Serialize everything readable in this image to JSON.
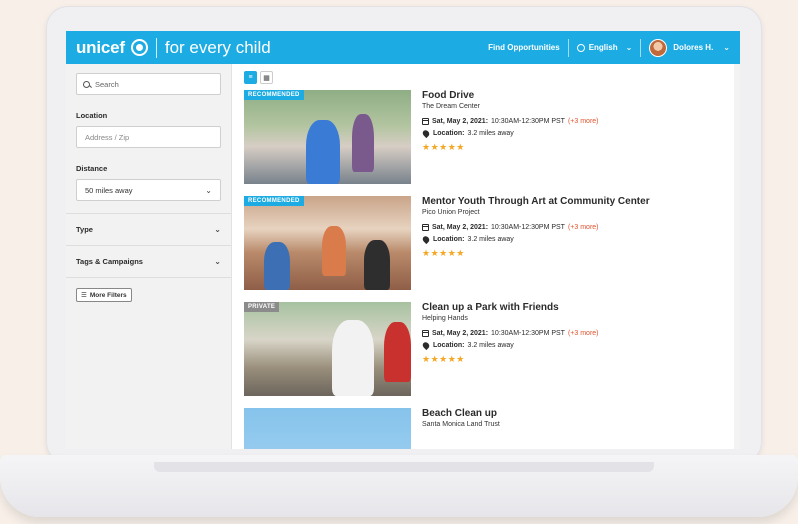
{
  "colors": {
    "brand": "#1cabe2",
    "accent_more": "#e2522c",
    "stars": "#f5a623"
  },
  "header": {
    "logo_word": "unicef",
    "tagline": "for every child",
    "find_opportunities": "Find Opportunities",
    "language": "English",
    "user_name": "Dolores H."
  },
  "sidebar": {
    "search_placeholder": "Search",
    "location_title": "Location",
    "address_placeholder": "Address / Zip",
    "distance_title": "Distance",
    "distance_value": "50 miles away",
    "type_label": "Type",
    "tags_label": "Tags & Campaigns",
    "more_filters": "More Filters"
  },
  "listings": [
    {
      "badge": "RECOMMENDED",
      "title": "Food Drive",
      "org": "The Dream Center",
      "date_label": "Sat, May 2, 2021:",
      "time": "10:30AM-12:30PM PST",
      "more": "(+3 more)",
      "location_label": "Location:",
      "distance": "3.2 miles away",
      "stars": "★★★★★"
    },
    {
      "badge": "RECOMMENDED",
      "title": "Mentor Youth Through Art at Community Center",
      "org": "Pico Union Project",
      "date_label": "Sat, May 2, 2021:",
      "time": "10:30AM-12:30PM PST",
      "more": "(+3 more)",
      "location_label": "Location:",
      "distance": "3.2 miles away",
      "stars": "★★★★★"
    },
    {
      "badge": "PRIVATE",
      "title": "Clean up a Park with Friends",
      "org": "Helping Hands",
      "date_label": "Sat, May 2, 2021:",
      "time": "10:30AM-12:30PM PST",
      "more": "(+3 more)",
      "location_label": "Location:",
      "distance": "3.2 miles away",
      "stars": "★★★★★"
    },
    {
      "title": "Beach Clean up",
      "org": "Santa Monica Land Trust"
    }
  ]
}
